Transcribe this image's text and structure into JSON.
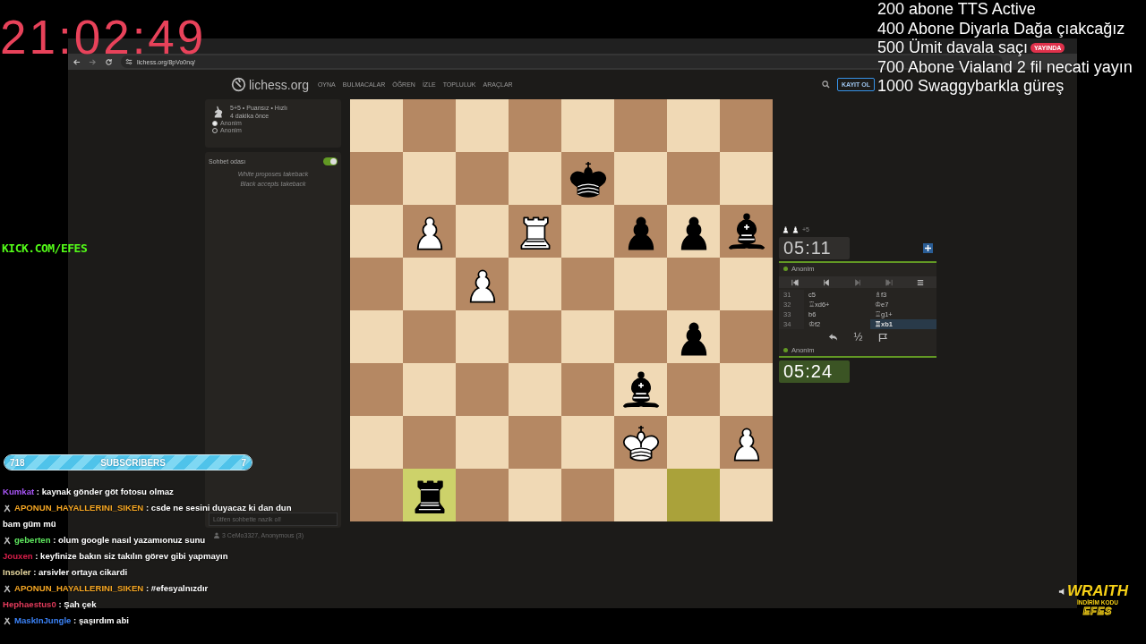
{
  "overlay": {
    "clock": "21:02:49",
    "channel": "KICK.COM/EFES",
    "goals": [
      {
        "text": "200 abone TTS Active"
      },
      {
        "text": "400 Abone Diyarla Dağa çıakcağız"
      },
      {
        "text": "500 Ümit davala saçı",
        "badge": "YAYINDA"
      },
      {
        "text": "700 Abone Vialand 2 fil necati yayın"
      },
      {
        "text": "1000 Swaggybarkla güreş"
      }
    ],
    "subscriber_goal": {
      "current": "718",
      "label": "SUBSCRIBERS",
      "target": "7",
      "level": 1
    },
    "chat": [
      {
        "user": "Kumkat",
        "color": "#a855f7",
        "badge": false,
        "text": ": kaynak gönder göt fotosu olmaz"
      },
      {
        "user": "APONUN_HAYALLERINI_SIKEN",
        "color": "#f5a623",
        "badge": true,
        "text": ": csde ne sesini duyacaz ki dan dun",
        "wrap": "bam güm mü"
      },
      {
        "user": "geberten",
        "color": "#5ee65e",
        "badge": true,
        "text": ": olum google nasıl yazamıonuz sunu"
      },
      {
        "user": "Jouxen",
        "color": "#d81e4a",
        "badge": false,
        "text": ": keyfinize bakın siz takılın görev gibi yapmayın"
      },
      {
        "user": "Insoler",
        "color": "#e8d9a0",
        "badge": false,
        "text": ": arsivler ortaya cikardi"
      },
      {
        "user": "APONUN_HAYALLERINI_SIKEN",
        "color": "#f5a623",
        "badge": true,
        "text": ": #efesyalnızdır"
      },
      {
        "user": "Hephaestus0",
        "color": "#e03a5a",
        "badge": false,
        "text": ": Şah çek"
      },
      {
        "user": "MaskInJungle",
        "color": "#3b82f6",
        "badge": true,
        "text": ": şaşırdım abi"
      }
    ],
    "sponsor": {
      "brand": "WRAITH",
      "caption": "İNDİRİM KODU",
      "code": "EFES"
    }
  },
  "browser": {
    "url": "lichess.org/8pVo0nq/"
  },
  "header": {
    "logo": "lichess.org",
    "nav": [
      "OYNA",
      "BULMACALAR",
      "ÖĞREN",
      "İZLE",
      "TOPLULUK",
      "ARAÇLAR"
    ],
    "signup": "KAYIT OL"
  },
  "game_info": {
    "mode": "5+5 • Puansız • Hızlı",
    "time": "4 dakika önce",
    "players": [
      {
        "name": "Anonim",
        "white": true
      },
      {
        "name": "Anonim",
        "white": false
      }
    ]
  },
  "chat_room": {
    "title": "Sohbet odası",
    "on": true,
    "messages": [
      "White proposes takeback",
      "Black accepts takeback"
    ],
    "placeholder": "Lütfen sohbette nazik ol!",
    "spectators": "3  CeMo3327, Anonymous (3)"
  },
  "board": {
    "rows": [
      {
        "cells": [
          {
            "kind": "empty",
            "highlighted": false
          },
          {
            "kind": "empty",
            "highlighted": false
          },
          {
            "kind": "empty",
            "highlighted": false
          },
          {
            "kind": "empty",
            "highlighted": false
          },
          {
            "kind": "empty",
            "highlighted": false
          },
          {
            "kind": "empty",
            "highlighted": false
          },
          {
            "kind": "empty",
            "highlighted": false
          },
          {
            "kind": "empty",
            "highlighted": false
          }
        ]
      },
      {
        "cells": [
          {
            "kind": "empty",
            "highlighted": false
          },
          {
            "kind": "empty",
            "highlighted": false
          },
          {
            "kind": "empty",
            "highlighted": false
          },
          {
            "kind": "empty",
            "highlighted": false
          },
          {
            "kind": "king",
            "white": false,
            "highlighted": false
          },
          {
            "kind": "empty",
            "highlighted": false
          },
          {
            "kind": "empty",
            "highlighted": false
          },
          {
            "kind": "empty",
            "highlighted": false
          }
        ]
      },
      {
        "cells": [
          {
            "kind": "empty",
            "highlighted": false
          },
          {
            "kind": "pawn",
            "white": true,
            "highlighted": false
          },
          {
            "kind": "empty",
            "highlighted": false
          },
          {
            "kind": "rook",
            "white": true,
            "highlighted": false
          },
          {
            "kind": "empty",
            "highlighted": false
          },
          {
            "kind": "pawn",
            "white": false,
            "highlighted": false
          },
          {
            "kind": "pawn",
            "white": false,
            "highlighted": false
          },
          {
            "kind": "bishop",
            "white": false,
            "highlighted": false
          }
        ]
      },
      {
        "cells": [
          {
            "kind": "empty",
            "highlighted": false
          },
          {
            "kind": "empty",
            "highlighted": false
          },
          {
            "kind": "pawn",
            "white": true,
            "highlighted": false
          },
          {
            "kind": "empty",
            "highlighted": false
          },
          {
            "kind": "empty",
            "highlighted": false
          },
          {
            "kind": "empty",
            "highlighted": false
          },
          {
            "kind": "empty",
            "highlighted": false
          },
          {
            "kind": "empty",
            "highlighted": false
          }
        ]
      },
      {
        "cells": [
          {
            "kind": "empty",
            "highlighted": false
          },
          {
            "kind": "empty",
            "highlighted": false
          },
          {
            "kind": "empty",
            "highlighted": false
          },
          {
            "kind": "empty",
            "highlighted": false
          },
          {
            "kind": "empty",
            "highlighted": false
          },
          {
            "kind": "empty",
            "highlighted": false
          },
          {
            "kind": "pawn",
            "white": false,
            "highlighted": false
          },
          {
            "kind": "empty",
            "highlighted": false
          }
        ]
      },
      {
        "cells": [
          {
            "kind": "empty",
            "highlighted": false
          },
          {
            "kind": "empty",
            "highlighted": false
          },
          {
            "kind": "empty",
            "highlighted": false
          },
          {
            "kind": "empty",
            "highlighted": false
          },
          {
            "kind": "empty",
            "highlighted": false
          },
          {
            "kind": "bishop",
            "white": false,
            "highlighted": false
          },
          {
            "kind": "empty",
            "highlighted": false
          },
          {
            "kind": "empty",
            "highlighted": false
          }
        ]
      },
      {
        "cells": [
          {
            "kind": "empty",
            "highlighted": false
          },
          {
            "kind": "empty",
            "highlighted": false
          },
          {
            "kind": "empty",
            "highlighted": false
          },
          {
            "kind": "empty",
            "highlighted": false
          },
          {
            "kind": "empty",
            "highlighted": false
          },
          {
            "kind": "king",
            "white": true,
            "highlighted": false
          },
          {
            "kind": "empty",
            "highlighted": false
          },
          {
            "kind": "pawn",
            "white": true,
            "highlighted": false
          }
        ]
      },
      {
        "cells": [
          {
            "kind": "empty",
            "highlighted": false
          },
          {
            "kind": "rook",
            "white": false,
            "highlighted": true
          },
          {
            "kind": "empty",
            "highlighted": false
          },
          {
            "kind": "empty",
            "highlighted": false
          },
          {
            "kind": "empty",
            "highlighted": false
          },
          {
            "kind": "empty",
            "highlighted": false
          },
          {
            "kind": "empty",
            "highlighted": true
          },
          {
            "kind": "empty",
            "highlighted": false
          }
        ]
      }
    ]
  },
  "side_panel": {
    "material": {
      "pieces": [
        {
          "kind": "pawn"
        },
        {
          "kind": "pawn"
        }
      ],
      "score": "+5"
    },
    "top_clock": {
      "time": "05:11",
      "running": false
    },
    "top_player": {
      "name": "Anonim",
      "online": true
    },
    "controls": [
      {
        "kind": "first",
        "disabled": false
      },
      {
        "kind": "prev",
        "disabled": false
      },
      {
        "kind": "next",
        "disabled": true
      },
      {
        "kind": "last",
        "disabled": true
      },
      {
        "kind": "menu",
        "disabled": false
      }
    ],
    "moves": [
      {
        "number": "31",
        "white": {
          "san": "c5",
          "selected": false
        },
        "black": {
          "san": "♗f3",
          "selected": false
        }
      },
      {
        "number": "32",
        "white": {
          "san": "♖xd6+",
          "selected": false
        },
        "black": {
          "san": "♔e7",
          "selected": false
        }
      },
      {
        "number": "33",
        "white": {
          "san": "b6",
          "selected": false
        },
        "black": {
          "san": "♖g1+",
          "selected": false
        }
      },
      {
        "number": "34",
        "white": {
          "san": "♔f2",
          "selected": false
        },
        "black": {
          "san": "♖xb1",
          "selected": true
        }
      }
    ],
    "draw_offer": "½",
    "bottom_player": {
      "name": "Anonim",
      "online": true
    },
    "bottom_clock": {
      "time": "05:24",
      "running": true
    }
  }
}
